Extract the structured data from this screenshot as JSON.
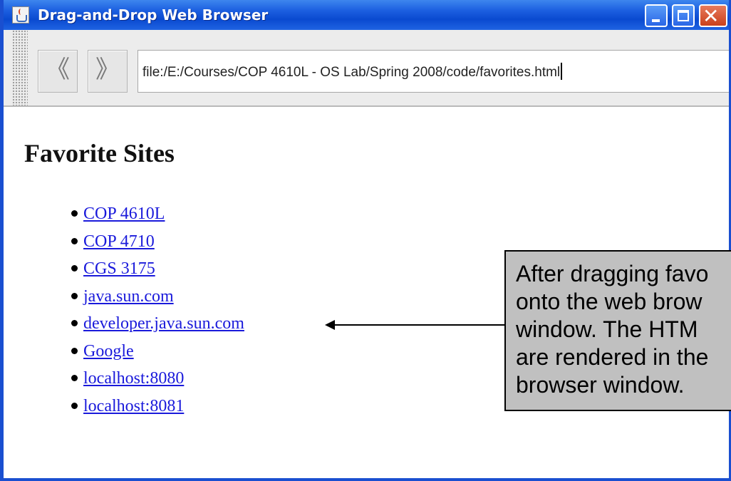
{
  "window": {
    "title": "Drag-and-Drop Web Browser",
    "controls": {
      "minimize": "minimize",
      "maximize": "maximize",
      "close": "✕"
    }
  },
  "toolbar": {
    "back_icon": "《",
    "forward_icon": "》",
    "url": "file:/E:/Courses/COP 4610L - OS Lab/Spring 2008/code/favorites.html"
  },
  "page": {
    "heading": "Favorite Sites",
    "links": [
      "COP 4610L",
      "COP 4710",
      "CGS 3175",
      "java.sun.com",
      "developer.java.sun.com",
      "Google",
      "localhost:8080",
      "localhost:8081"
    ]
  },
  "annotation": {
    "lines": [
      "After dragging favo",
      "onto the web brow",
      "window.  The HTM",
      "are rendered in the",
      "browser window."
    ]
  },
  "colors": {
    "title_bar": "#1c5fe0",
    "link": "#1a1adb",
    "callout_bg": "#c0c0c0"
  }
}
